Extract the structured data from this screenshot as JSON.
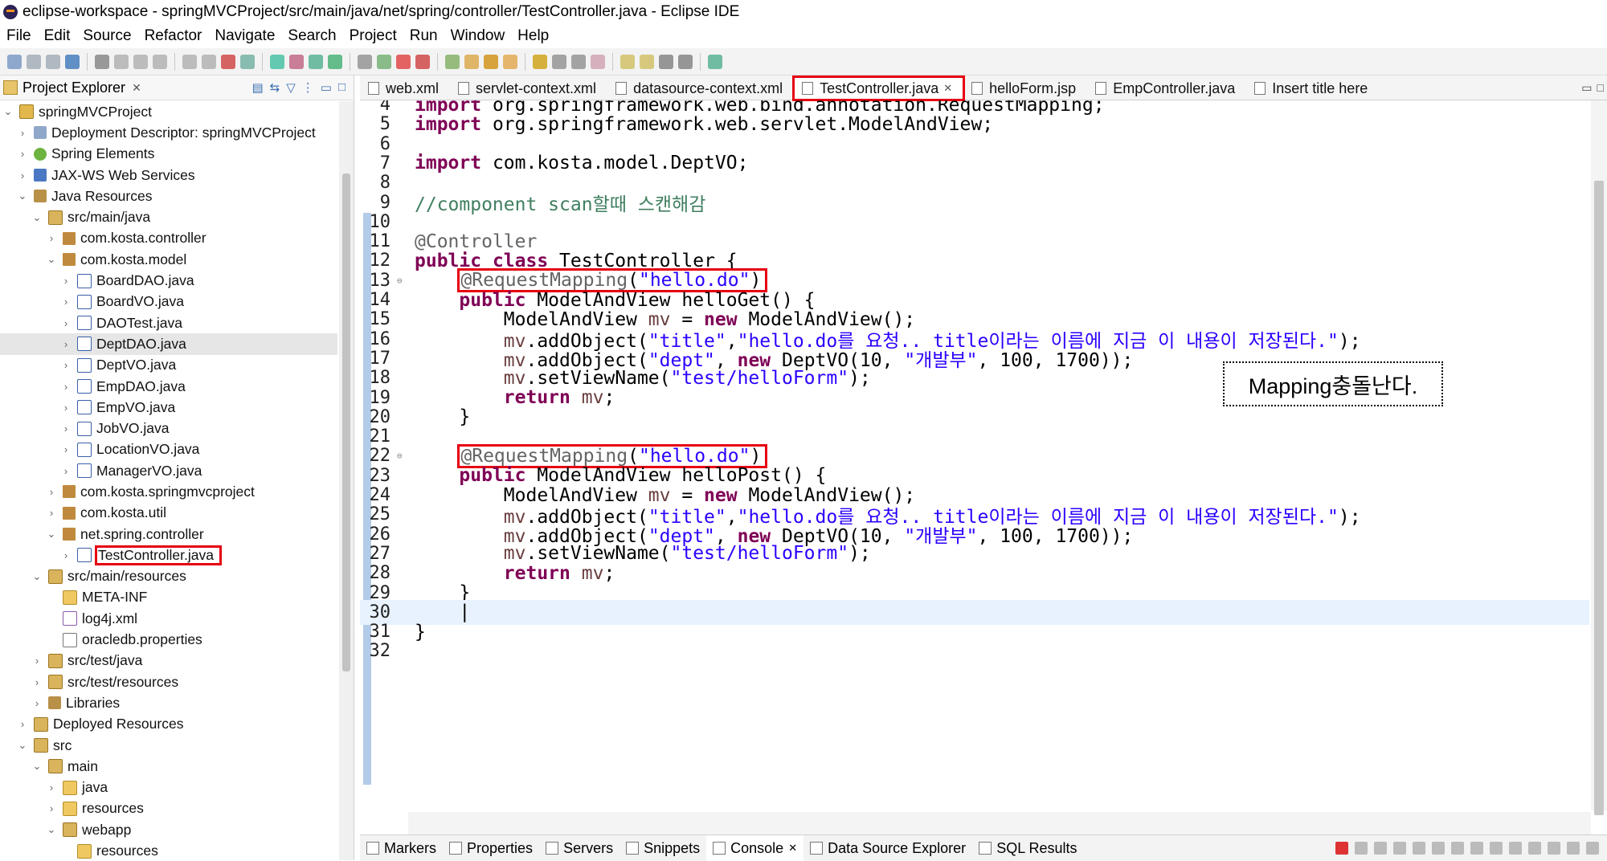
{
  "window": {
    "title": "eclipse-workspace - springMVCProject/src/main/java/net/spring/controller/TestController.java - Eclipse IDE"
  },
  "menu": [
    "File",
    "Edit",
    "Source",
    "Refactor",
    "Navigate",
    "Search",
    "Project",
    "Run",
    "Window",
    "Help"
  ],
  "project_explorer": {
    "tab_label": "Project Explorer",
    "close": "✕",
    "tree": [
      {
        "label": "springMVCProject",
        "depth": 0,
        "twisty": "⌄",
        "icon": "project-icon",
        "kind": "proj"
      },
      {
        "label": "Deployment Descriptor: springMVCProject",
        "depth": 1,
        "twisty": "›",
        "icon": "deployment-descriptor-icon",
        "kind": "cfg"
      },
      {
        "label": "Spring Elements",
        "depth": 1,
        "twisty": "›",
        "icon": "spring-icon",
        "kind": "spring"
      },
      {
        "label": "JAX-WS Web Services",
        "depth": 1,
        "twisty": "›",
        "icon": "webservice-icon",
        "kind": "ws"
      },
      {
        "label": "Java Resources",
        "depth": 1,
        "twisty": "⌄",
        "icon": "java-resources-icon",
        "kind": "lib"
      },
      {
        "label": "src/main/java",
        "depth": 2,
        "twisty": "⌄",
        "icon": "source-folder-icon",
        "kind": "srcf"
      },
      {
        "label": "com.kosta.controller",
        "depth": 3,
        "twisty": "›",
        "icon": "package-icon",
        "kind": "pkg"
      },
      {
        "label": "com.kosta.model",
        "depth": 3,
        "twisty": "⌄",
        "icon": "package-icon",
        "kind": "pkg"
      },
      {
        "label": "BoardDAO.java",
        "depth": 4,
        "twisty": "›",
        "icon": "java-file-icon",
        "kind": "java"
      },
      {
        "label": "BoardVO.java",
        "depth": 4,
        "twisty": "›",
        "icon": "java-file-icon",
        "kind": "java"
      },
      {
        "label": "DAOTest.java",
        "depth": 4,
        "twisty": "›",
        "icon": "java-file-icon",
        "kind": "java"
      },
      {
        "label": "DeptDAO.java",
        "depth": 4,
        "twisty": "›",
        "icon": "java-file-icon",
        "kind": "java",
        "selected": true
      },
      {
        "label": "DeptVO.java",
        "depth": 4,
        "twisty": "›",
        "icon": "java-file-icon",
        "kind": "java"
      },
      {
        "label": "EmpDAO.java",
        "depth": 4,
        "twisty": "›",
        "icon": "java-file-icon",
        "kind": "java"
      },
      {
        "label": "EmpVO.java",
        "depth": 4,
        "twisty": "›",
        "icon": "java-file-icon",
        "kind": "java"
      },
      {
        "label": "JobVO.java",
        "depth": 4,
        "twisty": "›",
        "icon": "java-file-icon",
        "kind": "java"
      },
      {
        "label": "LocationVO.java",
        "depth": 4,
        "twisty": "›",
        "icon": "java-file-icon",
        "kind": "java"
      },
      {
        "label": "ManagerVO.java",
        "depth": 4,
        "twisty": "›",
        "icon": "java-file-icon",
        "kind": "java"
      },
      {
        "label": "com.kosta.springmvcproject",
        "depth": 3,
        "twisty": "›",
        "icon": "package-icon",
        "kind": "pkg"
      },
      {
        "label": "com.kosta.util",
        "depth": 3,
        "twisty": "›",
        "icon": "package-icon",
        "kind": "pkg"
      },
      {
        "label": "net.spring.controller",
        "depth": 3,
        "twisty": "⌄",
        "icon": "package-icon",
        "kind": "pkg"
      },
      {
        "label": "TestController.java",
        "depth": 4,
        "twisty": "›",
        "icon": "java-file-icon",
        "kind": "java",
        "highlight": true
      },
      {
        "label": "src/main/resources",
        "depth": 2,
        "twisty": "⌄",
        "icon": "source-folder-icon",
        "kind": "srcf"
      },
      {
        "label": "META-INF",
        "depth": 3,
        "twisty": "",
        "icon": "folder-icon",
        "kind": "folder"
      },
      {
        "label": "log4j.xml",
        "depth": 3,
        "twisty": "",
        "icon": "xml-file-icon",
        "kind": "xml"
      },
      {
        "label": "oracledb.properties",
        "depth": 3,
        "twisty": "",
        "icon": "properties-file-icon",
        "kind": "prop"
      },
      {
        "label": "src/test/java",
        "depth": 2,
        "twisty": "›",
        "icon": "source-folder-icon",
        "kind": "srcf"
      },
      {
        "label": "src/test/resources",
        "depth": 2,
        "twisty": "›",
        "icon": "source-folder-icon",
        "kind": "srcf"
      },
      {
        "label": "Libraries",
        "depth": 2,
        "twisty": "›",
        "icon": "libraries-icon",
        "kind": "lib"
      },
      {
        "label": "Deployed Resources",
        "depth": 1,
        "twisty": "›",
        "icon": "deployed-resources-icon",
        "kind": "srcf"
      },
      {
        "label": "src",
        "depth": 1,
        "twisty": "⌄",
        "icon": "folder-icon",
        "kind": "srcf"
      },
      {
        "label": "main",
        "depth": 2,
        "twisty": "⌄",
        "icon": "folder-icon",
        "kind": "srcf"
      },
      {
        "label": "java",
        "depth": 3,
        "twisty": "›",
        "icon": "folder-icon",
        "kind": "folder"
      },
      {
        "label": "resources",
        "depth": 3,
        "twisty": "›",
        "icon": "folder-icon",
        "kind": "folder"
      },
      {
        "label": "webapp",
        "depth": 3,
        "twisty": "⌄",
        "icon": "folder-icon",
        "kind": "srcf"
      },
      {
        "label": "resources",
        "depth": 4,
        "twisty": "",
        "icon": "folder-icon",
        "kind": "folder"
      }
    ]
  },
  "editor": {
    "tabs": [
      {
        "label": "web.xml",
        "active": false
      },
      {
        "label": "servlet-context.xml",
        "active": false
      },
      {
        "label": "datasource-context.xml",
        "active": false
      },
      {
        "label": "TestController.java",
        "active": true,
        "highlight": true,
        "close": "✕"
      },
      {
        "label": "helloForm.jsp",
        "active": false
      },
      {
        "label": "EmpController.java",
        "active": false
      },
      {
        "label": "Insert title here",
        "active": false
      }
    ],
    "callout": "Mapping충돌난다.",
    "lines": [
      {
        "n": "4",
        "html": "<span class='kw'>import</span> org.springframework.web.bind.annotation.RequestMapping;"
      },
      {
        "n": "5",
        "html": "<span class='kw'>import</span> org.springframework.web.servlet.ModelAndView;"
      },
      {
        "n": "6",
        "html": ""
      },
      {
        "n": "7",
        "html": "<span class='kw'>import</span> com.kosta.model.DeptVO;"
      },
      {
        "n": "8",
        "html": ""
      },
      {
        "n": "9",
        "html": "<span class='cmt'>//component scan할때 스캔해감</span>"
      },
      {
        "n": "10",
        "html": ""
      },
      {
        "n": "11",
        "html": "<span class='ann'>@Controller</span>"
      },
      {
        "n": "12",
        "html": "<span class='kw'>public</span> <span class='kw'>class</span> TestController {"
      },
      {
        "n": "13",
        "fold": "⊖",
        "html": "    <span class='hl1 redbox'><span class='ann'>@RequestMapping</span>(<span class='str'>\"hello.do\"</span>)</span>"
      },
      {
        "n": "14",
        "html": "    <span class='kw'>public</span> ModelAndView helloGet() {"
      },
      {
        "n": "15",
        "html": "        ModelAndView <span class='var'>mv</span> = <span class='kw'>new</span> ModelAndView();"
      },
      {
        "n": "16",
        "html": "        <span class='var'>mv</span>.addObject(<span class='str'>\"title\"</span>,<span class='str'>\"hello.do를 요청.. title이라는 이름에 지금 이 내용이 저장된다.\"</span>);"
      },
      {
        "n": "17",
        "html": "        <span class='var'>mv</span>.addObject(<span class='str'>\"dept\"</span>, <span class='kw'>new</span> DeptVO(10, <span class='str'>\"개발부\"</span>, 100, 1700));"
      },
      {
        "n": "18",
        "html": "        <span class='var'>mv</span>.setViewName(<span class='str'>\"test/helloForm\"</span>);"
      },
      {
        "n": "19",
        "html": "        <span class='kw'>return</span> <span class='var'>mv</span>;"
      },
      {
        "n": "20",
        "html": "    }"
      },
      {
        "n": "21",
        "html": ""
      },
      {
        "n": "22",
        "fold": "⊖",
        "html": "    <span class='hl1 redbox'><span class='ann'>@RequestMapping</span>(<span class='str'>\"hello.do\"</span>)</span>"
      },
      {
        "n": "23",
        "html": "    <span class='kw'>public</span> ModelAndView helloPost() {"
      },
      {
        "n": "24",
        "html": "        ModelAndView <span class='var'>mv</span> = <span class='kw'>new</span> ModelAndView();"
      },
      {
        "n": "25",
        "html": "        <span class='var'>mv</span>.addObject(<span class='str'>\"title\"</span>,<span class='str'>\"hello.do를 요청.. title이라는 이름에 지금 이 내용이 저장된다.\"</span>);"
      },
      {
        "n": "26",
        "html": "        <span class='var'>mv</span>.addObject(<span class='str'>\"dept\"</span>, <span class='kw'>new</span> DeptVO(10, <span class='str'>\"개발부\"</span>, 100, 1700));"
      },
      {
        "n": "27",
        "html": "        <span class='var'>mv</span>.setViewName(<span class='str'>\"test/helloForm\"</span>);"
      },
      {
        "n": "28",
        "html": "        <span class='kw'>return</span> <span class='var'>mv</span>;"
      },
      {
        "n": "29",
        "html": "    }"
      },
      {
        "n": "30",
        "html": "    |",
        "current": true
      },
      {
        "n": "31",
        "html": "}"
      },
      {
        "n": "32",
        "html": ""
      }
    ]
  },
  "bottom_panel": {
    "tabs": [
      {
        "label": "Markers",
        "active": false
      },
      {
        "label": "Properties",
        "active": false
      },
      {
        "label": "Servers",
        "active": false
      },
      {
        "label": "Snippets",
        "active": false
      },
      {
        "label": "Console",
        "active": true,
        "close": "✕"
      },
      {
        "label": "Data Source Explorer",
        "active": false
      },
      {
        "label": "SQL Results",
        "active": false
      }
    ]
  }
}
